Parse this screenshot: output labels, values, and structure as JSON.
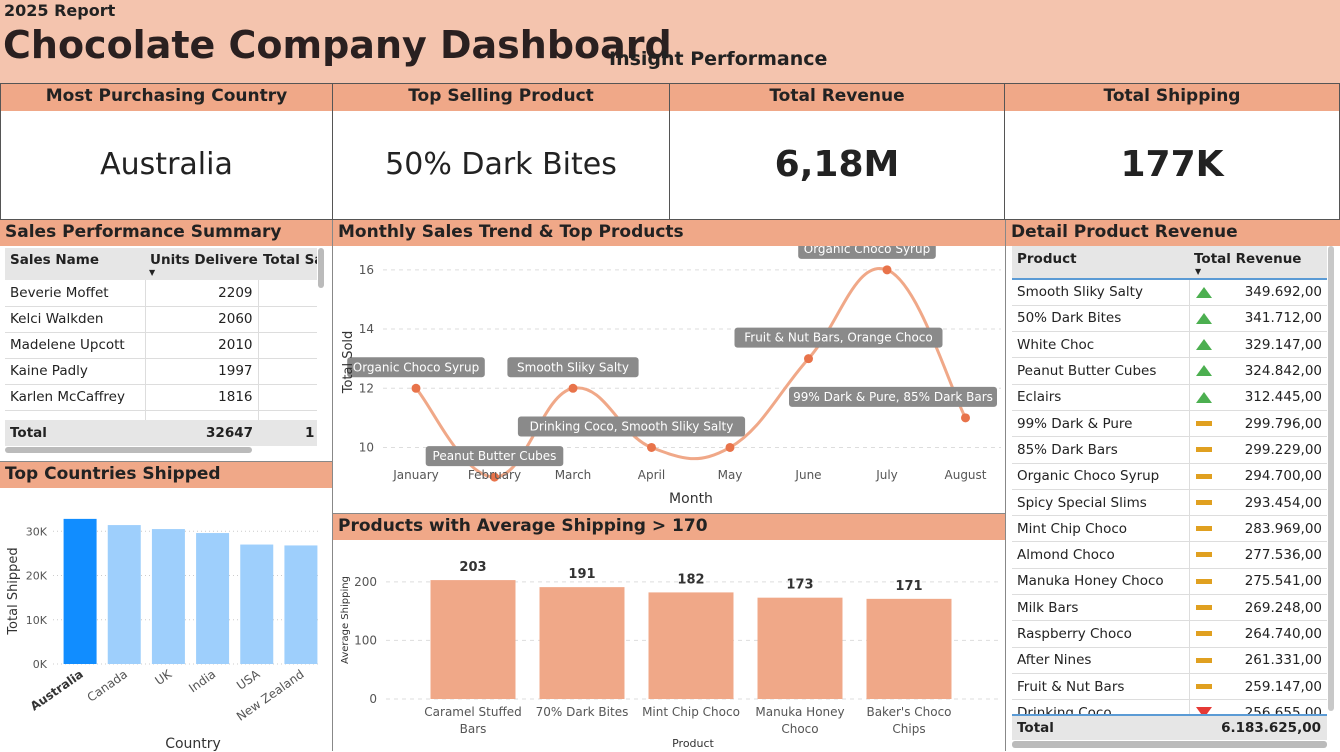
{
  "header": {
    "year": "2025 Report",
    "title": "Chocolate Company Dashboard",
    "subtitle": "Insight Performance"
  },
  "kpis": [
    {
      "label": "Most Purchasing Country",
      "value": "Australia"
    },
    {
      "label": "Top Selling Product",
      "value": "50% Dark Bites"
    },
    {
      "label": "Total Revenue",
      "value": "6,18M"
    },
    {
      "label": "Total Shipping",
      "value": "177K"
    }
  ],
  "sales": {
    "title": "Sales Performance Summary",
    "columns": [
      "Sales Name",
      "Units Delivered",
      "Total Sa"
    ],
    "rows": [
      [
        "Beverie Moffet",
        "2209"
      ],
      [
        "Kelci Walkden",
        "2060"
      ],
      [
        "Madelene Upcott",
        "2010"
      ],
      [
        "Kaine Padly",
        "1997"
      ],
      [
        "Karlen McCaffrey",
        "1816"
      ]
    ],
    "total_label": "Total",
    "total_units": "32647",
    "total_sales": "1"
  },
  "countries": {
    "title": "Top Countries Shipped"
  },
  "trend": {
    "title": "Monthly Sales Trend & Top Products"
  },
  "shipping": {
    "title": "Products with Average Shipping > 170"
  },
  "detail": {
    "title": "Detail Product Revenue",
    "columns": [
      "Product",
      "Total Revenue"
    ],
    "rows": [
      {
        "product": "Smooth Sliky Salty",
        "revenue": "349.692,00",
        "status": "up"
      },
      {
        "product": "50% Dark Bites",
        "revenue": "341.712,00",
        "status": "up"
      },
      {
        "product": "White Choc",
        "revenue": "329.147,00",
        "status": "up"
      },
      {
        "product": "Peanut Butter Cubes",
        "revenue": "324.842,00",
        "status": "up"
      },
      {
        "product": "Eclairs",
        "revenue": "312.445,00",
        "status": "up"
      },
      {
        "product": "99% Dark & Pure",
        "revenue": "299.796,00",
        "status": "flat"
      },
      {
        "product": "85% Dark Bars",
        "revenue": "299.229,00",
        "status": "flat"
      },
      {
        "product": "Organic Choco Syrup",
        "revenue": "294.700,00",
        "status": "flat"
      },
      {
        "product": "Spicy Special Slims",
        "revenue": "293.454,00",
        "status": "flat"
      },
      {
        "product": "Mint Chip Choco",
        "revenue": "283.969,00",
        "status": "flat"
      },
      {
        "product": "Almond Choco",
        "revenue": "277.536,00",
        "status": "flat"
      },
      {
        "product": "Manuka Honey Choco",
        "revenue": "275.541,00",
        "status": "flat"
      },
      {
        "product": "Milk Bars",
        "revenue": "269.248,00",
        "status": "flat"
      },
      {
        "product": "Raspberry Choco",
        "revenue": "264.740,00",
        "status": "flat"
      },
      {
        "product": "After Nines",
        "revenue": "261.331,00",
        "status": "flat"
      },
      {
        "product": "Fruit & Nut Bars",
        "revenue": "259.147,00",
        "status": "flat"
      },
      {
        "product": "Drinking Coco",
        "revenue": "256.655,00",
        "status": "down"
      }
    ],
    "total_label": "Total",
    "total_revenue": "6.183.625,00"
  },
  "colors": {
    "header_bg": "#f4c4ae",
    "section_bg": "#f0a888",
    "accent": "#e8734a",
    "bar_highlight": "#118dff",
    "bar_light": "#9ecffc",
    "bar_salmon": "#f0a888",
    "up": "#4caf50",
    "flat": "#e0a020",
    "down": "#e53935"
  },
  "chart_data": [
    {
      "type": "bar",
      "title": "Top Countries Shipped",
      "xlabel": "Country",
      "ylabel": "Total Shipped",
      "categories": [
        "Australia",
        "Canada",
        "UK",
        "India",
        "USA",
        "New Zealand"
      ],
      "values": [
        32800,
        31400,
        30500,
        29600,
        27000,
        26800
      ],
      "ylim": [
        0,
        33000
      ],
      "tick_values": [
        0,
        10000,
        20000,
        30000
      ],
      "tick_labels": [
        "0K",
        "10K",
        "20K",
        "30K"
      ],
      "highlight": "Australia"
    },
    {
      "type": "line",
      "title": "Monthly Sales Trend & Top Products",
      "xlabel": "Month",
      "ylabel": "Total Sold",
      "categories": [
        "January",
        "February",
        "March",
        "April",
        "May",
        "June",
        "July",
        "August"
      ],
      "values": [
        12,
        9,
        12,
        10,
        10,
        13,
        16,
        11
      ],
      "ylim": [
        9,
        16.5
      ],
      "tick_values": [
        10,
        12,
        14,
        16
      ],
      "annotations": [
        "Organic Choco Syrup",
        "Peanut Butter Cubes",
        "Smooth Sliky Salty",
        "Drinking Coco, Smooth Sliky Salty",
        "",
        "Fruit & Nut Bars, Orange Choco",
        "Organic Choco Syrup",
        "99% Dark & Pure, 85% Dark Bars"
      ]
    },
    {
      "type": "bar",
      "title": "Products with Average Shipping > 170",
      "xlabel": "Product",
      "ylabel": "Average Shipping",
      "categories": [
        "Caramel Stuffed Bars",
        "70% Dark Bites",
        "Mint Chip Choco",
        "Manuka Honey Choco",
        "Baker's Choco Chips"
      ],
      "values": [
        203,
        191,
        182,
        173,
        171
      ],
      "ylim": [
        0,
        210
      ],
      "tick_values": [
        0,
        100,
        200
      ]
    }
  ]
}
